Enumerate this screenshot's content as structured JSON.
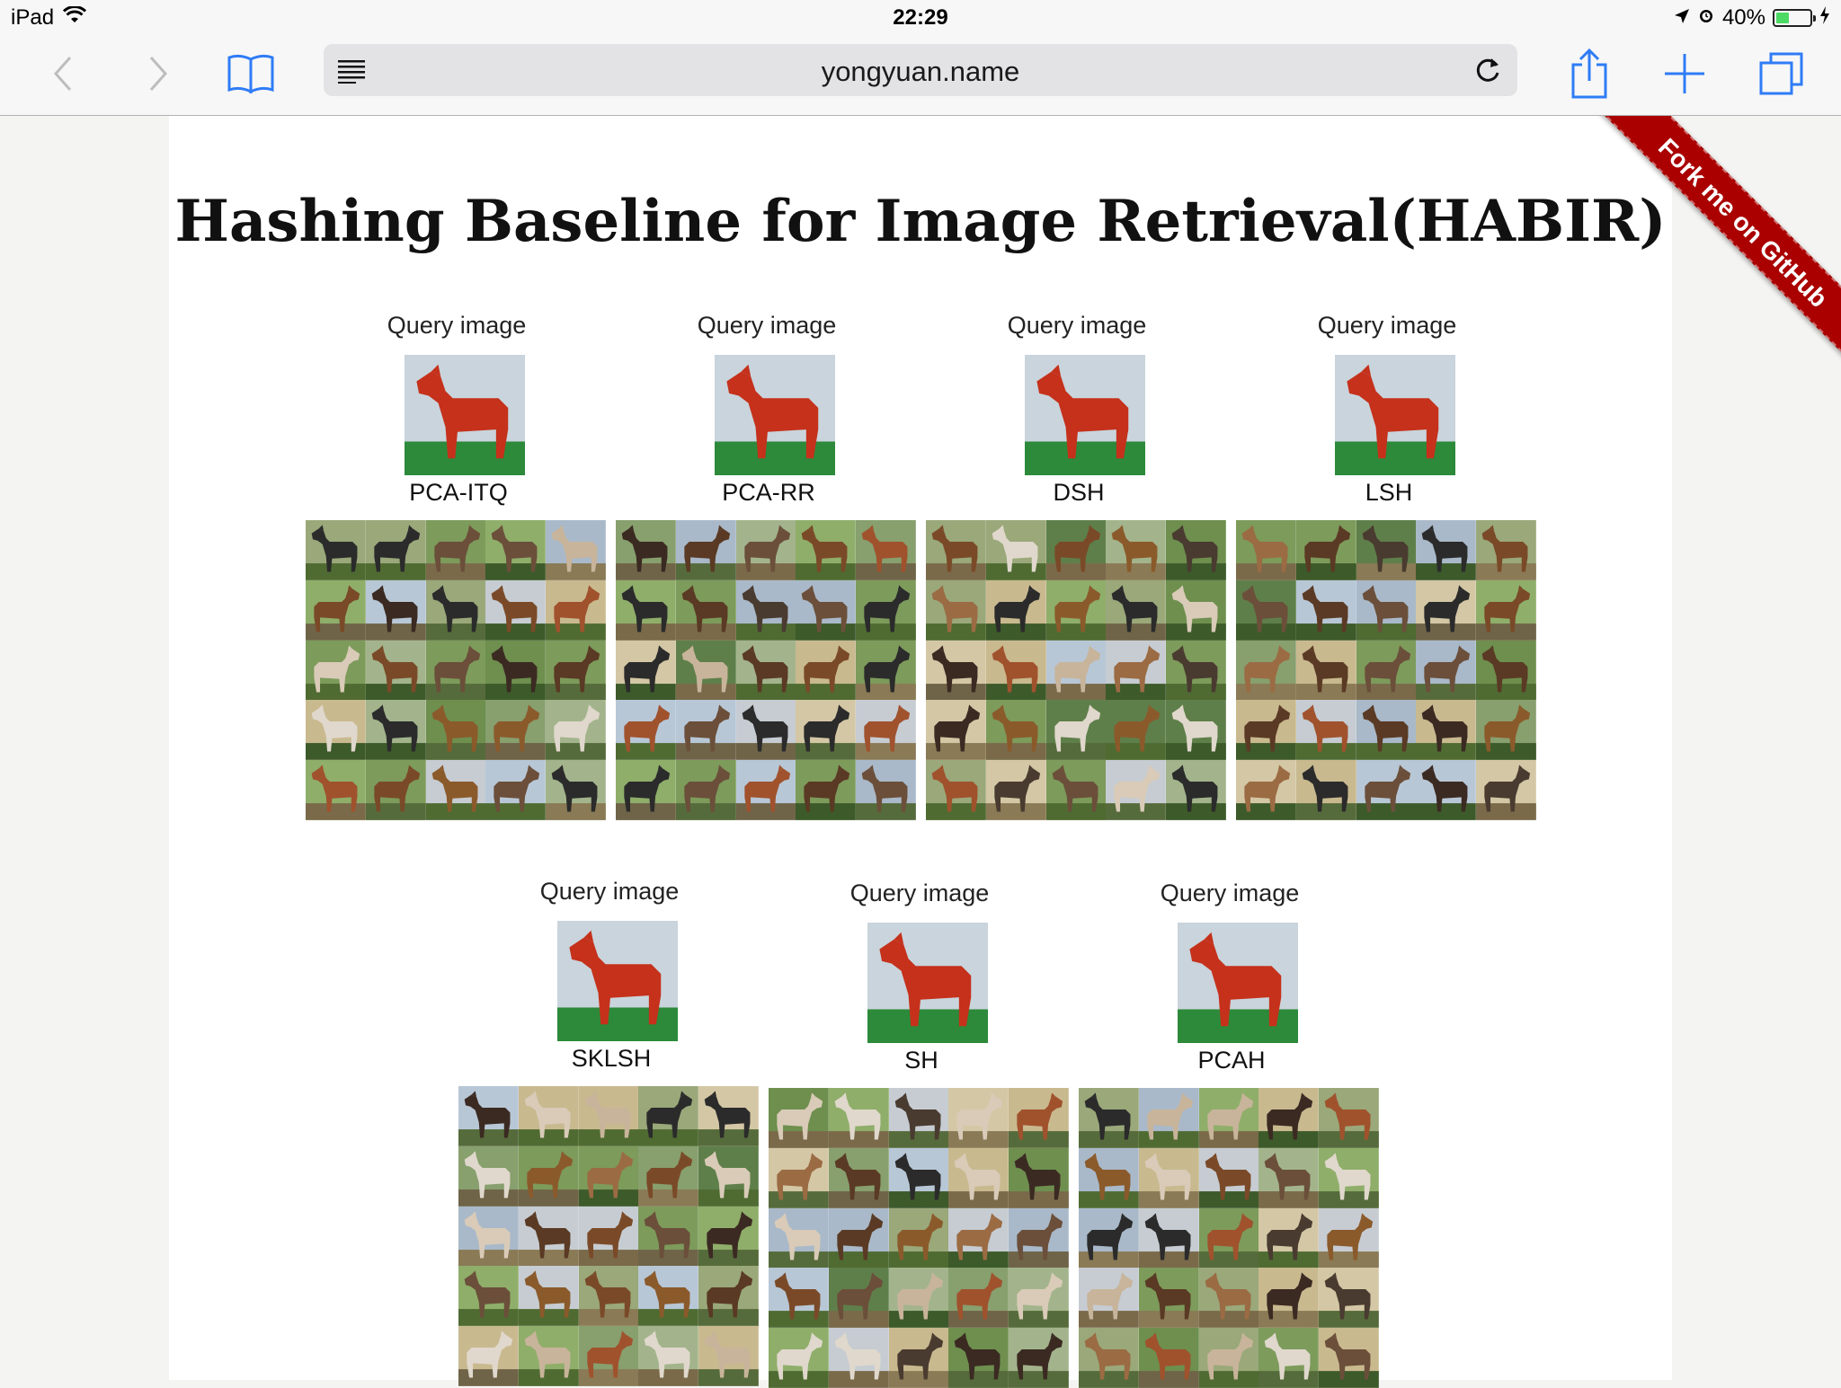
{
  "status_bar": {
    "device": "iPad",
    "time": "22:29",
    "battery_percent_text": "40%",
    "battery_level": 0.4
  },
  "browser": {
    "url": "yongyuan.name"
  },
  "page": {
    "title": "Hashing Baseline for Image Retrieval(HABIR)",
    "ribbon_text": "Fork me on GitHub",
    "query_label": "Query image",
    "methods_row1": [
      "PCA-ITQ",
      "PCA-RR",
      "DSH",
      "LSH"
    ],
    "methods_row2": [
      "SKLSH",
      "SH",
      "PCAH"
    ]
  },
  "colors": {
    "accent_blue": "#2f7cf6",
    "ribbon_red": "#aa0000",
    "battery_green": "#4cd964"
  }
}
